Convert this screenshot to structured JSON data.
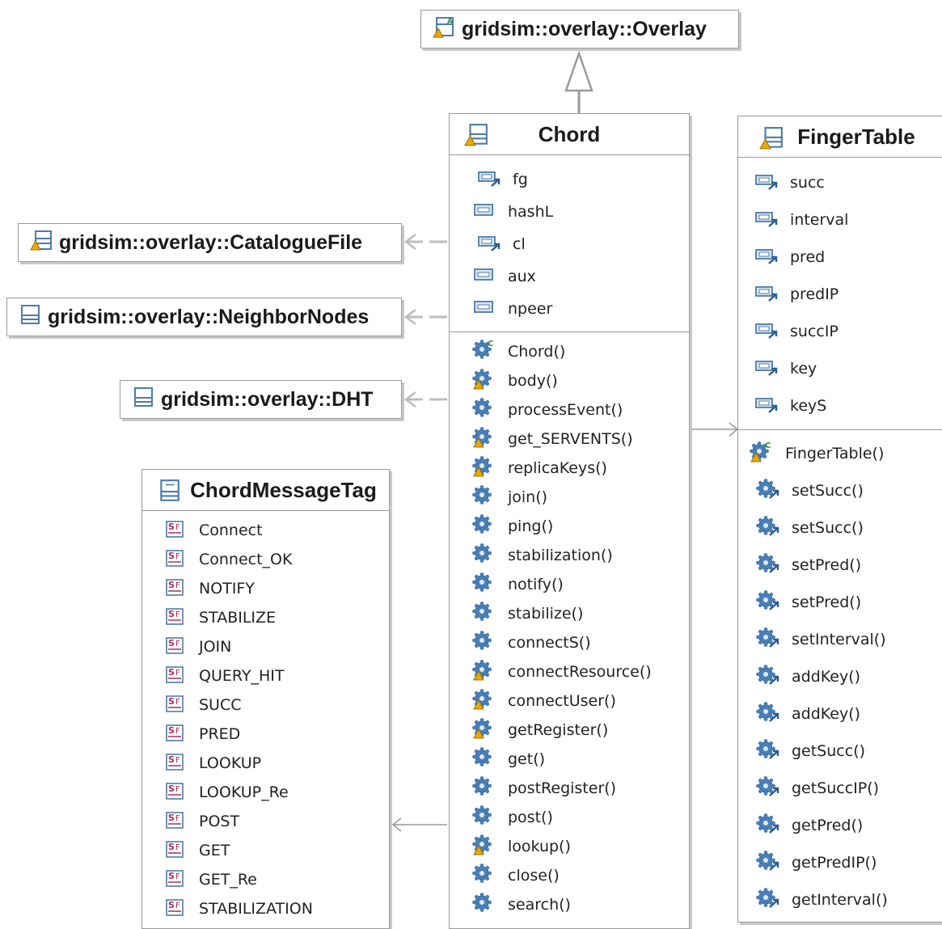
{
  "colors": {
    "border": "#9a9a9a",
    "shadow": "#c8c8c8",
    "field_icon": "#4d7ca8",
    "gear_icon": "#3a6ea5",
    "static_icon": "#a23060",
    "warn_icon": "#e8a800"
  },
  "overlay": {
    "name": "gridsim::overlay::Overlay"
  },
  "refs": {
    "catalogue": "gridsim::overlay::CatalogueFile",
    "neighbor": "gridsim::overlay::NeighborNodes",
    "dht": "gridsim::overlay::DHT"
  },
  "chord": {
    "name": "Chord",
    "fields": [
      "fg",
      "hashL",
      "cl",
      "aux",
      "npeer"
    ],
    "methods": [
      "Chord()",
      "body()",
      "processEvent()",
      "get_SERVENTS()",
      "replicaKeys()",
      "join()",
      "ping()",
      "stabilization()",
      "notify()",
      "stabilize()",
      "connectS()",
      "connectResource()",
      "connectUser()",
      "getRegister()",
      "get()",
      "postRegister()",
      "post()",
      "lookup()",
      "close()",
      "search()"
    ]
  },
  "fingertable": {
    "name": "FingerTable",
    "fields": [
      "succ",
      "interval",
      "pred",
      "predIP",
      "succIP",
      "key",
      "keyS"
    ],
    "methods": [
      "FingerTable()",
      "setSucc()",
      "setSucc()",
      "setPred()",
      "setPred()",
      "setInterval()",
      "addKey()",
      "addKey()",
      "getSucc()",
      "getSuccIP()",
      "getPred()",
      "getPredIP()",
      "getInterval()"
    ]
  },
  "messagetag": {
    "name": "ChordMessageTag",
    "constants": [
      "Connect",
      "Connect_OK",
      "NOTIFY",
      "STABILIZE",
      "JOIN",
      "QUERY_HIT",
      "SUCC",
      "PRED",
      "LOOKUP",
      "LOOKUP_Re",
      "POST",
      "GET",
      "GET_Re",
      "STABILIZATION"
    ]
  }
}
